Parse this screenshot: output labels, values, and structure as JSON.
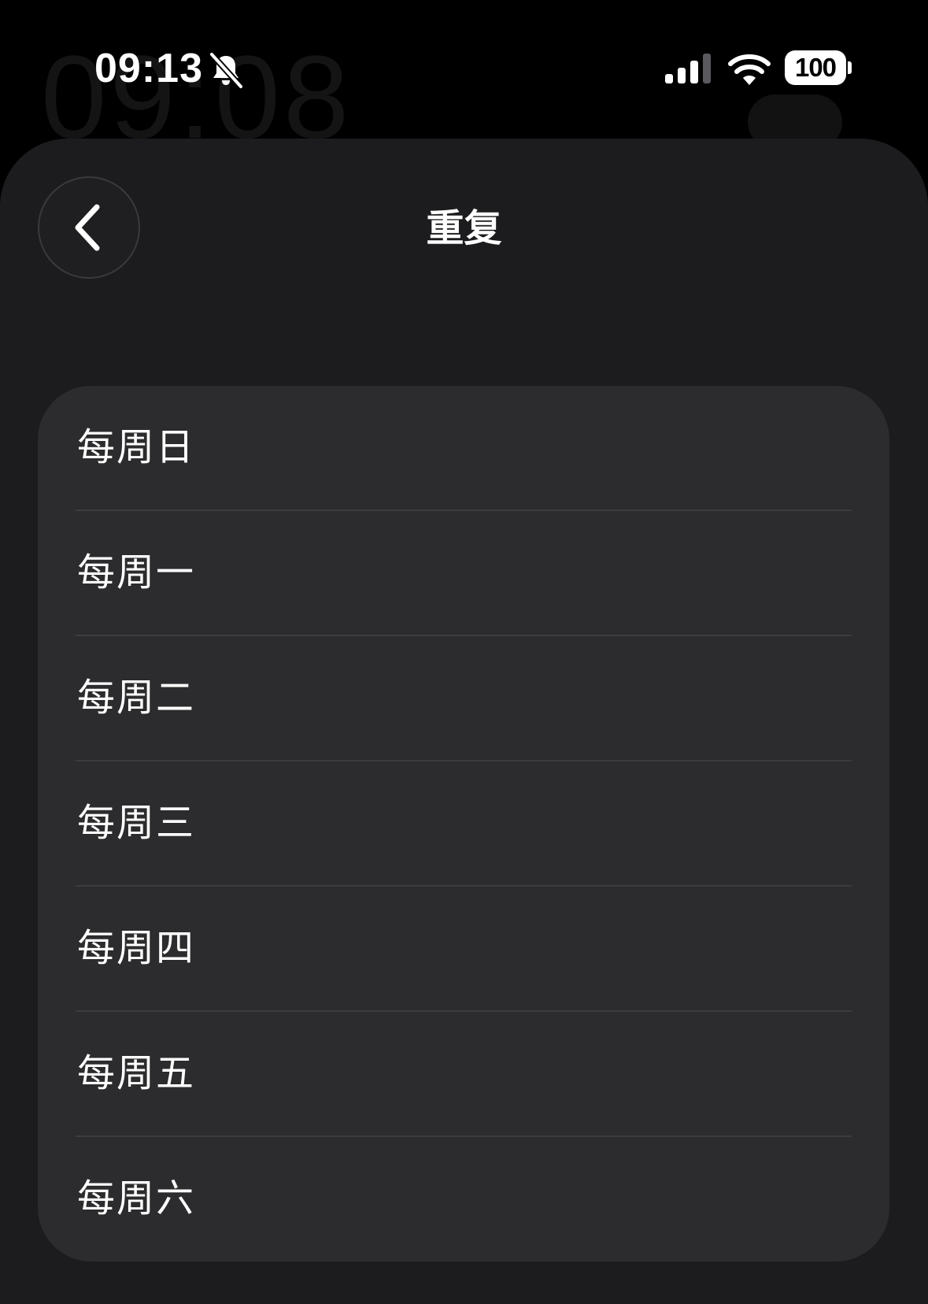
{
  "status_bar": {
    "time": "09:13",
    "battery": "100",
    "icons": [
      "bell-slash-icon",
      "cellular-signal-icon",
      "wifi-icon",
      "battery-icon"
    ]
  },
  "background": {
    "clock": "09:08"
  },
  "header": {
    "title": "重复",
    "back_icon": "chevron-left-icon"
  },
  "repeat_options": [
    {
      "label": "每周日"
    },
    {
      "label": "每周一"
    },
    {
      "label": "每周二"
    },
    {
      "label": "每周三"
    },
    {
      "label": "每周四"
    },
    {
      "label": "每周五"
    },
    {
      "label": "每周六"
    }
  ],
  "colors": {
    "background": "#000000",
    "sheet": "#1c1c1e",
    "card": "#2c2c2e",
    "separator": "#3c3c40",
    "text": "#ffffff"
  }
}
